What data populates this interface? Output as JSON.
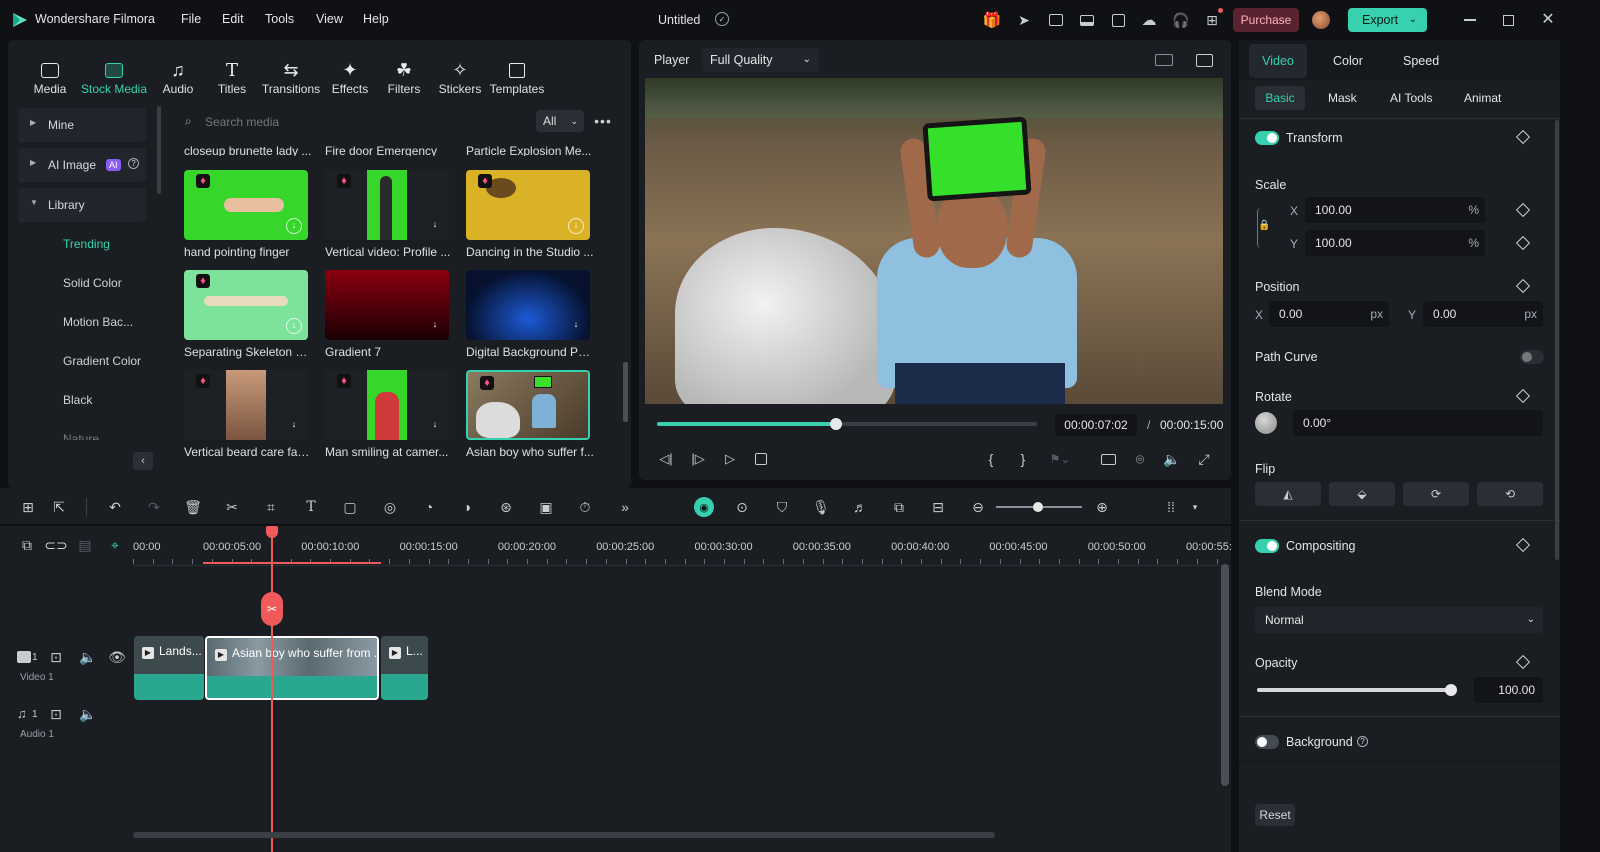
{
  "app": {
    "name": "Wondershare Filmora",
    "project_title": "Untitled"
  },
  "menu": [
    "File",
    "Edit",
    "Tools",
    "View",
    "Help"
  ],
  "titlebar": {
    "purchase_label": "Purchase",
    "export_label": "Export"
  },
  "media_tabs": [
    {
      "label": "Media",
      "icon": "media-icon"
    },
    {
      "label": "Stock Media",
      "icon": "stock-media-icon"
    },
    {
      "label": "Audio",
      "icon": "audio-icon"
    },
    {
      "label": "Titles",
      "icon": "titles-icon"
    },
    {
      "label": "Transitions",
      "icon": "transitions-icon"
    },
    {
      "label": "Effects",
      "icon": "effects-icon"
    },
    {
      "label": "Filters",
      "icon": "filters-icon"
    },
    {
      "label": "Stickers",
      "icon": "stickers-icon"
    },
    {
      "label": "Templates",
      "icon": "templates-icon"
    }
  ],
  "sidebar": {
    "mine": "Mine",
    "ai_image": "AI Image",
    "ai_badge": "AI",
    "library": "Library",
    "items": [
      "Trending",
      "Solid Color",
      "Motion Bac...",
      "Gradient Color",
      "Black",
      "Nature"
    ]
  },
  "search": {
    "placeholder": "Search media",
    "filter": "All"
  },
  "grid_top_labels": [
    "closeup brunette lady ...",
    "Fire door Emergency",
    "Particle Explosion Me..."
  ],
  "media_items": [
    {
      "label": "hand pointing finger"
    },
    {
      "label": "Vertical video: Profile ..."
    },
    {
      "label": "Dancing in the Studio ..."
    },
    {
      "label": "Separating Skeleton H..."
    },
    {
      "label": "Gradient 7"
    },
    {
      "label": "Digital Background Pa..."
    },
    {
      "label": "Vertical beard care faci..."
    },
    {
      "label": "Man smiling at camer..."
    },
    {
      "label": "Asian boy who suffer f..."
    }
  ],
  "player": {
    "label": "Player",
    "quality": "Full Quality",
    "current_time": "00:00:07:02",
    "separator": "/",
    "total_time": "00:00:15:00",
    "progress": 0.47
  },
  "properties": {
    "tabs": [
      "Video",
      "Color",
      "Speed"
    ],
    "subtabs": [
      "Basic",
      "Mask",
      "AI Tools",
      "Animat"
    ],
    "transform_label": "Transform",
    "scale_label": "Scale",
    "scale_x_axis": "X",
    "scale_x": "100.00",
    "scale_y_axis": "Y",
    "scale_y": "100.00",
    "percent": "%",
    "position_label": "Position",
    "pos_x_axis": "X",
    "pos_x": "0.00",
    "pos_y_axis": "Y",
    "pos_y": "0.00",
    "px": "px",
    "path_curve_label": "Path Curve",
    "rotate_label": "Rotate",
    "rotate_value": "0.00°",
    "flip_label": "Flip",
    "compositing_label": "Compositing",
    "blend_mode_label": "Blend Mode",
    "blend_mode_value": "Normal",
    "opacity_label": "Opacity",
    "opacity_value": "100.00",
    "opacity_fraction": 1.0,
    "background_label": "Background",
    "reset_label": "Reset"
  },
  "timeline": {
    "ruler": [
      "00:00",
      "00:00:05:00",
      "00:00:10:00",
      "00:00:15:00",
      "00:00:20:00",
      "00:00:25:00",
      "00:00:30:00",
      "00:00:35:00",
      "00:00:40:00",
      "00:00:45:00",
      "00:00:50:00",
      "00:00:55:"
    ],
    "tracks": [
      {
        "name": "Video 1",
        "number": "1"
      },
      {
        "name": "Audio 1",
        "number": "1"
      }
    ],
    "clips": [
      {
        "label": "Lands..."
      },
      {
        "label": "Asian boy who suffer from ..."
      },
      {
        "label": "L..."
      }
    ]
  },
  "colors": {
    "accent": "#37d1b0",
    "playhead": "#f05a5a",
    "purchase": "#6b2a35",
    "export": "#37d1b0"
  }
}
